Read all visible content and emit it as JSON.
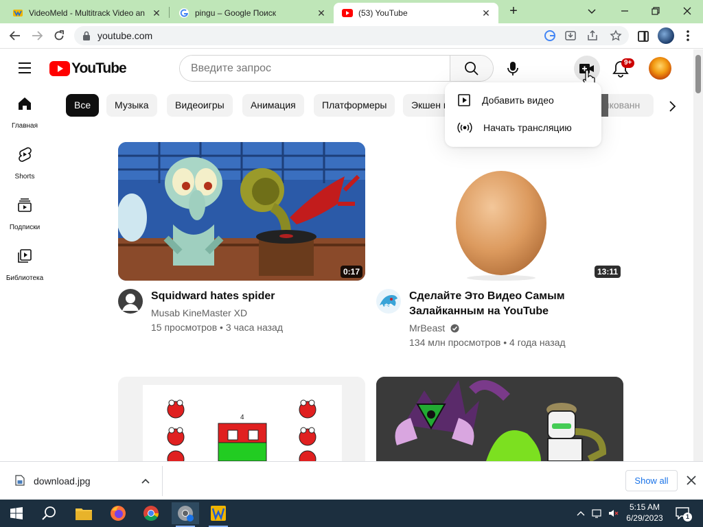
{
  "browser": {
    "tabs": [
      {
        "title": "VideoMeld - Multitrack Video an",
        "icon": "videomeld-icon"
      },
      {
        "title": "pingu – Google Поиск",
        "icon": "google-icon"
      },
      {
        "title": "(53) YouTube",
        "icon": "youtube-icon",
        "active": true
      }
    ],
    "url": "youtube.com"
  },
  "youtube": {
    "search_placeholder": "Введите запрос",
    "notification_badge": "9+",
    "chips": [
      "Все",
      "Музыка",
      "Видеоигры",
      "Анимация",
      "Платформеры",
      "Экшен и",
      "рикованн"
    ],
    "sidebar": [
      {
        "label": "Главная",
        "icon": "home-icon"
      },
      {
        "label": "Shorts",
        "icon": "shorts-icon"
      },
      {
        "label": "Подписки",
        "icon": "subscriptions-icon"
      },
      {
        "label": "Библиотека",
        "icon": "library-icon"
      }
    ],
    "create_menu": [
      {
        "label": "Добавить видео",
        "icon": "upload-video-icon"
      },
      {
        "label": "Начать трансляцию",
        "icon": "live-broadcast-icon"
      }
    ],
    "videos": [
      {
        "title": "Squidward hates spider",
        "channel": "Musab KineMaster XD",
        "views": "15 просмотров",
        "age": "3 часа назад",
        "duration": "0:17"
      },
      {
        "title": "Сделайте Это Видео Самым Залайканным на YouTube",
        "channel": "MrBeast",
        "views": "134 млн просмотров",
        "age": "4 года назад",
        "duration": "13:11",
        "verified": true
      }
    ],
    "row2_thumb_label": "4"
  },
  "downloads": {
    "filename": "download.jpg",
    "show_all": "Show all"
  },
  "taskbar": {
    "time": "5:15 AM",
    "date": "6/29/2023",
    "notification_count": "1"
  }
}
